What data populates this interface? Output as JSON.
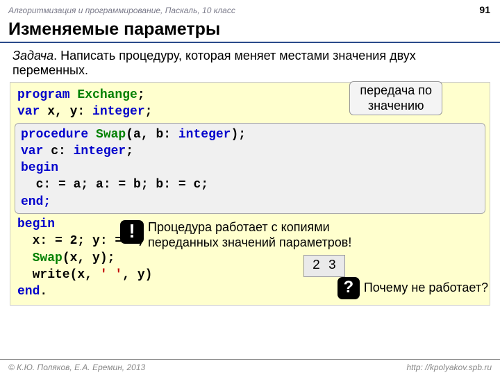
{
  "header": {
    "breadcrumb": "Алгоритмизация и программирование, Паскаль, 10 класс",
    "page": "91"
  },
  "title": "Изменяемые параметры",
  "task": {
    "label": "Задача",
    "text": ". Написать процедуру, которая меняет местами значения двух переменных."
  },
  "code": {
    "l1a": "program",
    "l1b": " Exchange",
    "l1c": ";",
    "l2a": "var",
    "l2b": " x, y: ",
    "l2c": "integer",
    "l2d": ";",
    "p1a": "procedure",
    "p1b": " Swap",
    "p1c": "(a, b: ",
    "p1d": "integer",
    "p1e": ");",
    "p2a": "var",
    "p2b": " c: ",
    "p2c": "integer",
    "p2d": ";",
    "p3": "begin",
    "p4": "  c: = a; a: = b; b: = c;",
    "p5": "end;",
    "l3": "begin",
    "l4": "  x: = 2; y: = 3;",
    "l5a": "  Swap",
    "l5b": "(x, y);",
    "l6a": "  write(x, ",
    "l6b": "' '",
    "l6c": ", y)",
    "l7a": "end",
    "l7b": "."
  },
  "callouts": {
    "pass_l1": "передача по",
    "pass_l2": "значению",
    "warn_icon": "!",
    "warn_l1": "Процедура работает с копиями",
    "warn_l2": "переданных значений параметров!",
    "output": "2 3",
    "q_icon": "?",
    "q_text": "Почему не работает?"
  },
  "footer": {
    "copyright": "© К.Ю. Поляков, Е.А. Еремин, 2013",
    "url": "http: //kpolyakov.spb.ru"
  }
}
